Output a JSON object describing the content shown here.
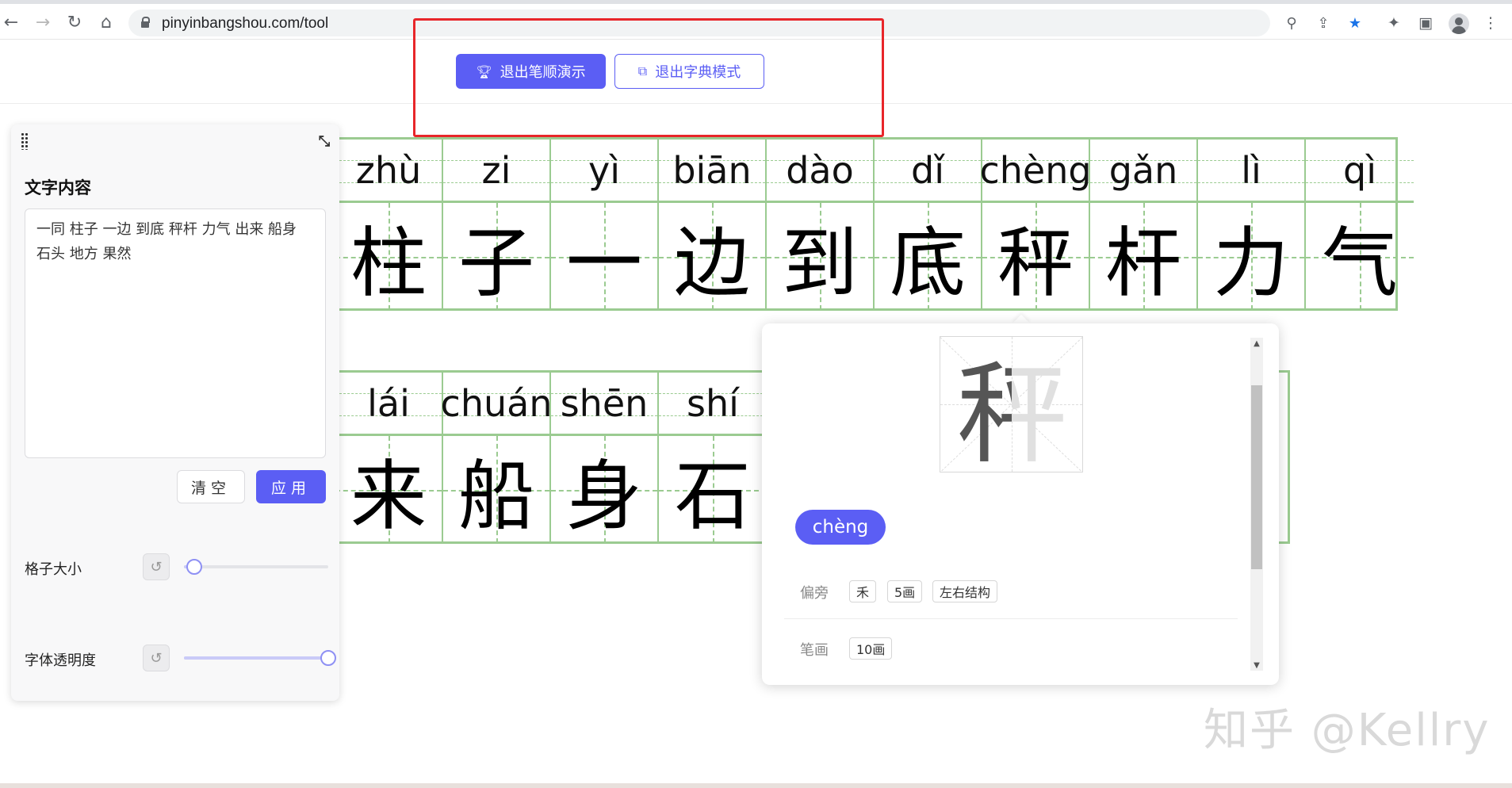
{
  "browser": {
    "url": "pinyinbangshou.com/tool"
  },
  "header": {
    "exit_stroke_demo": "退出笔顺演示",
    "exit_dict_mode": "退出字典模式"
  },
  "grid_row_1": [
    {
      "pinyin": "zhù",
      "char": "柱"
    },
    {
      "pinyin": "zi",
      "char": "子"
    },
    {
      "pinyin": "yì",
      "char": "一"
    },
    {
      "pinyin": "biān",
      "char": "边"
    },
    {
      "pinyin": "dào",
      "char": "到"
    },
    {
      "pinyin": "dǐ",
      "char": "底"
    },
    {
      "pinyin": "chèng",
      "char": "秤"
    },
    {
      "pinyin": "gǎn",
      "char": "杆"
    },
    {
      "pinyin": "lì",
      "char": "力"
    },
    {
      "pinyin": "qì",
      "char": "气"
    }
  ],
  "grid_row_2": [
    {
      "pinyin": "lái",
      "char": "来"
    },
    {
      "pinyin": "chuán",
      "char": "船"
    },
    {
      "pinyin": "shēn",
      "char": "身"
    },
    {
      "pinyin": "shí",
      "char": "石"
    }
  ],
  "panel": {
    "title": "文字内容",
    "text": "一同 柱子 一边 到底 秤杆 力气 出来 船身 石头 地方 果然",
    "clear_label": "清空",
    "apply_label": "应用",
    "grid_size_label": "格子大小",
    "grid_size_value": 0.07,
    "opacity_label": "字体透明度",
    "opacity_value": 1.0
  },
  "dictionary": {
    "char": "秤",
    "pinyin": "chèng",
    "radical_label": "偏旁",
    "radical": "禾",
    "radical_strokes": "5画",
    "structure": "左右结构",
    "strokes_label": "笔画",
    "strokes": "10画"
  },
  "watermark": "知乎 @Kellry",
  "colors": {
    "accent": "#5b5ef4",
    "grid_green": "#9bcb91",
    "highlight_red": "#e8262a"
  }
}
